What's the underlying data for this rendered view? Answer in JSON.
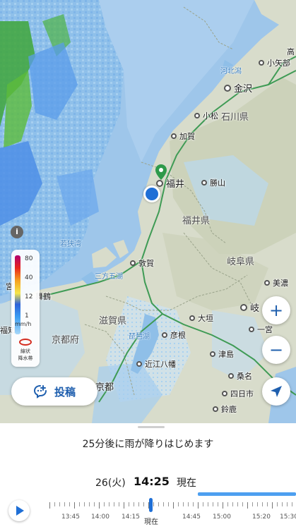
{
  "map": {
    "cities": [
      {
        "name": "小矢部",
        "label": "小矢部"
      },
      {
        "name": "金沢",
        "label": "金沢"
      },
      {
        "name": "小松",
        "label": "小松"
      },
      {
        "name": "加賀",
        "label": "加賀"
      },
      {
        "name": "福井",
        "label": "福井"
      },
      {
        "name": "勝山",
        "label": "勝山"
      },
      {
        "name": "敦賀",
        "label": "敦賀"
      },
      {
        "name": "美濃",
        "label": "美濃"
      },
      {
        "name": "大垣",
        "label": "大垣"
      },
      {
        "name": "岐阜",
        "label": "岐"
      },
      {
        "name": "彦根",
        "label": "彦根"
      },
      {
        "name": "一宮",
        "label": "一宮"
      },
      {
        "name": "津島",
        "label": "津島"
      },
      {
        "name": "近江八幡",
        "label": "近江八幡"
      },
      {
        "name": "桑名",
        "label": "桑名"
      },
      {
        "name": "京都",
        "label": "京都"
      },
      {
        "name": "四日市",
        "label": "四日市"
      },
      {
        "name": "鈴鹿",
        "label": "鈴鹿"
      }
    ],
    "prefectures": {
      "ishikawa": "石川県",
      "fukui": "福井県",
      "gifu": "岐阜県",
      "shiga": "滋賀県",
      "kyoto": "京都府"
    },
    "water_labels": {
      "wakasa": "若狭湾",
      "mikata": "三方五湖",
      "biwa": "琵琶湖",
      "kahoku": "河北潟"
    },
    "edge_labels": {
      "miyazu": "宮",
      "maizuru": "舞鶴",
      "fukuchiyama": "福知山",
      "takaoka_partial": "高"
    },
    "user_location_color": "#1f6fd6",
    "pin_color": "#2e9a4a"
  },
  "legend": {
    "ticks": [
      "80",
      "40",
      "12",
      "1"
    ],
    "unit": "mm/h",
    "band_label_1": "線状",
    "band_label_2": "降水帯"
  },
  "controls": {
    "info": "i",
    "post_label": "投稿",
    "zoom_in": "+",
    "zoom_out": "−"
  },
  "forecast": {
    "message": "25分後に雨が降りはじめます",
    "date": "26(火)",
    "time": "14:25",
    "now_label": "現在"
  },
  "timeline": {
    "labels": [
      "13:45",
      "14:00",
      "14:15",
      "14:45",
      "15:00",
      "15:20",
      "15:30"
    ],
    "now_marker": "現在",
    "position_fraction": 0.41
  },
  "colors": {
    "accent": "#1f6fd6",
    "brand": "#1f5fae",
    "sea": "#9ec6ea",
    "land": "#d8dccb"
  }
}
